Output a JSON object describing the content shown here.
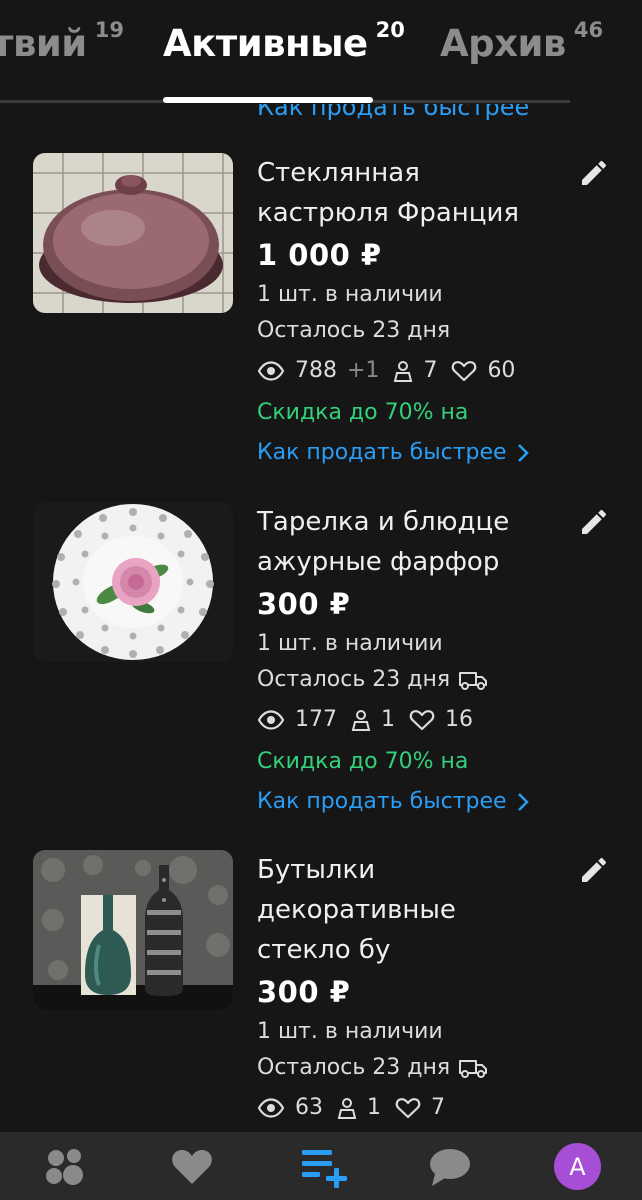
{
  "tabs": [
    {
      "label": "твий",
      "count": "19"
    },
    {
      "label": "Активные",
      "count": "20"
    },
    {
      "label": "Архив",
      "count": "46"
    }
  ],
  "top_link": "Как продать быстрее",
  "listings": [
    {
      "title_line1": "Стеклянная",
      "title_line2": "кастрюля Франция",
      "price": "1 000 ₽",
      "stock": "1 шт. в наличии",
      "remaining": "Осталось 23 дня",
      "views": "788",
      "views_plus": "+1",
      "contacts": "7",
      "favorites": "60",
      "discount": "Скидка до 70% на",
      "sell_link": "Как продать быстрее"
    },
    {
      "title_line1": "Тарелка и блюдце",
      "title_line2": "ажурные фарфор",
      "price": "300 ₽",
      "stock": "1 шт. в наличии",
      "remaining": "Осталось 23 дня",
      "views": "177",
      "contacts": "1",
      "favorites": "16",
      "discount": "Скидка до 70% на",
      "sell_link": "Как продать быстрее"
    },
    {
      "title_line1": "Бутылки",
      "title_line2": "декоративные",
      "title_line3": "стекло бу",
      "price": "300 ₽",
      "stock": "1 шт. в наличии",
      "remaining": "Осталось 23 дня",
      "views": "63",
      "contacts": "1",
      "favorites": "7"
    }
  ],
  "nav": {
    "items": [
      "services-icon",
      "favorites-icon",
      "add-listing-icon",
      "messages-icon",
      "profile-avatar"
    ],
    "avatar_letter": "A"
  },
  "colors": {
    "background": "#161616",
    "link": "#2a9df4",
    "discount": "#33d17a",
    "avatar": "#a64fd6",
    "active_nav": "#2a9df4"
  }
}
